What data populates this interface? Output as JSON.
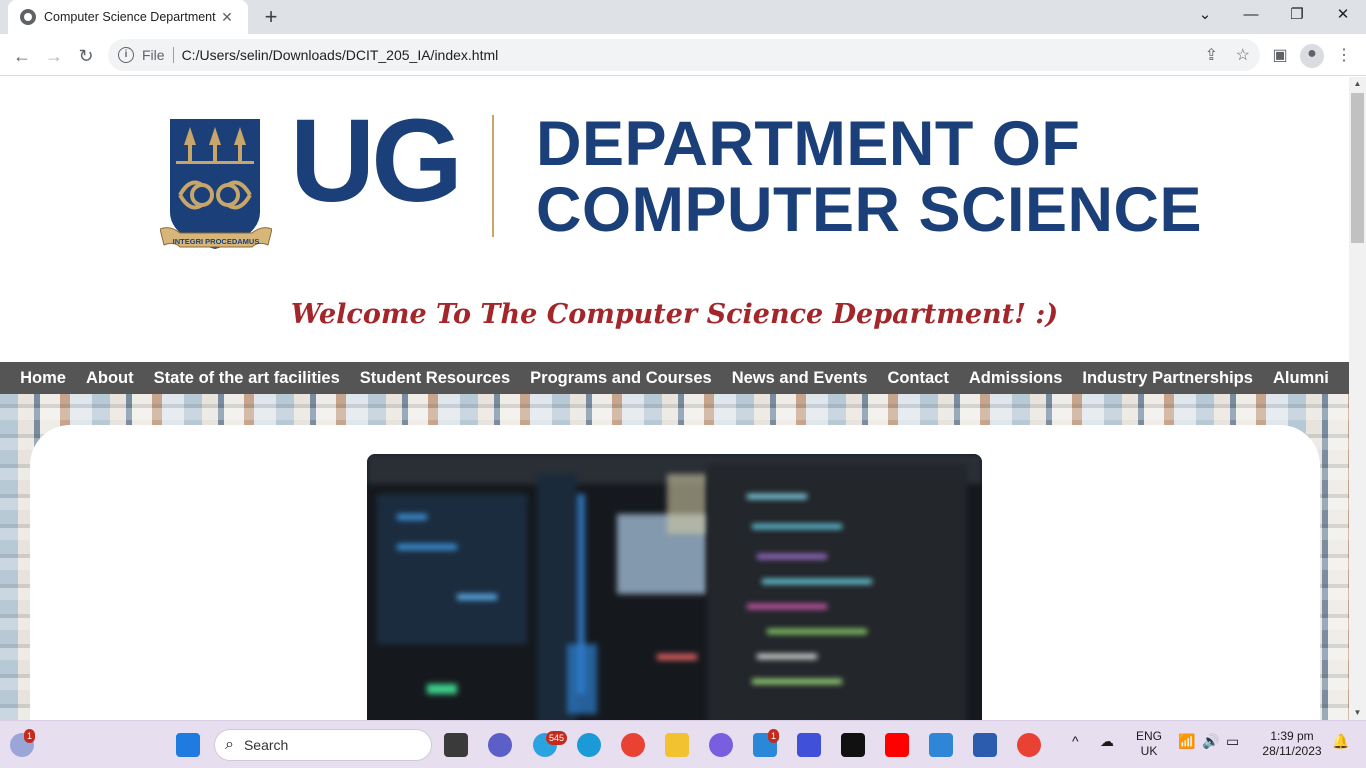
{
  "browser": {
    "tab_title": "Computer Science Department",
    "tab_close": "✕",
    "new_tab": "+",
    "omnibox_scheme": "File",
    "url": "C:/Users/selin/Downloads/DCIT_205_IA/index.html"
  },
  "header": {
    "ug": "UG",
    "dept_line1": "DEPARTMENT OF",
    "dept_line2": "COMPUTER SCIENCE",
    "crest_motto": "INTEGRI PROCEDAMUS",
    "welcome": "Welcome To The Computer Science Department! :)"
  },
  "nav": {
    "items": [
      "Home",
      "About",
      "State of the art facilities",
      "Student Resources",
      "Programs and Courses",
      "News and Events",
      "Contact",
      "Admissions",
      "Industry Partnerships",
      "Alumni"
    ]
  },
  "taskbar": {
    "search_label": "Search",
    "widgets_badge": "1",
    "telegram_badge": "545",
    "mail_badge": "1",
    "lang": "ENG",
    "region": "UK",
    "time": "1:39 pm",
    "date": "28/11/2023"
  },
  "colors": {
    "brand_blue": "#1b3f78",
    "gold": "#c8a66a",
    "welcome_red": "#a3262a",
    "nav_bg": "#555555"
  }
}
